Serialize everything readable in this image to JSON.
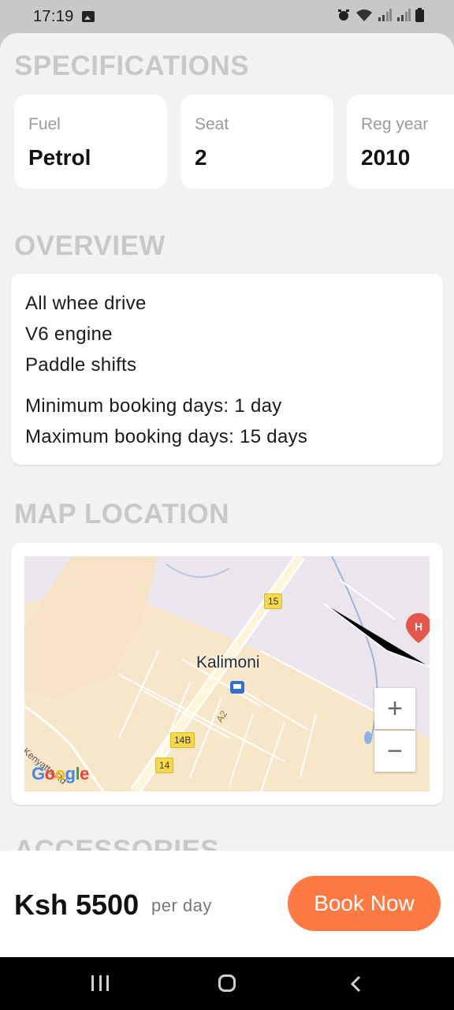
{
  "status": {
    "time": "17:19"
  },
  "specifications": {
    "title": "SPECIFICATIONS",
    "items": [
      {
        "label": "Fuel",
        "value": "Petrol"
      },
      {
        "label": "Seat",
        "value": "2"
      },
      {
        "label": "Reg year",
        "value": "2010"
      }
    ]
  },
  "overview": {
    "title": "OVERVIEW",
    "features": [
      "All whee drive",
      "V6 engine",
      "Paddle shifts"
    ],
    "min_booking": "Minimum booking days: 1 day",
    "max_booking": "Maximum booking days: 15 days"
  },
  "map": {
    "title": "MAP LOCATION",
    "place": "Kalimoni",
    "road_labels": [
      "15",
      "14B",
      "14"
    ],
    "road_name": "Kenyatta Rd",
    "highway": "A2",
    "zoom_in": "+",
    "zoom_out": "−",
    "logo": "Google"
  },
  "accessories": {
    "title": "ACCESSORIES"
  },
  "booking": {
    "price": "Ksh 5500",
    "unit": "per day",
    "button": "Book Now"
  },
  "colors": {
    "accent": "#ff7a43",
    "section_title": "#c8c8c8",
    "background": "#f2f2f2"
  }
}
